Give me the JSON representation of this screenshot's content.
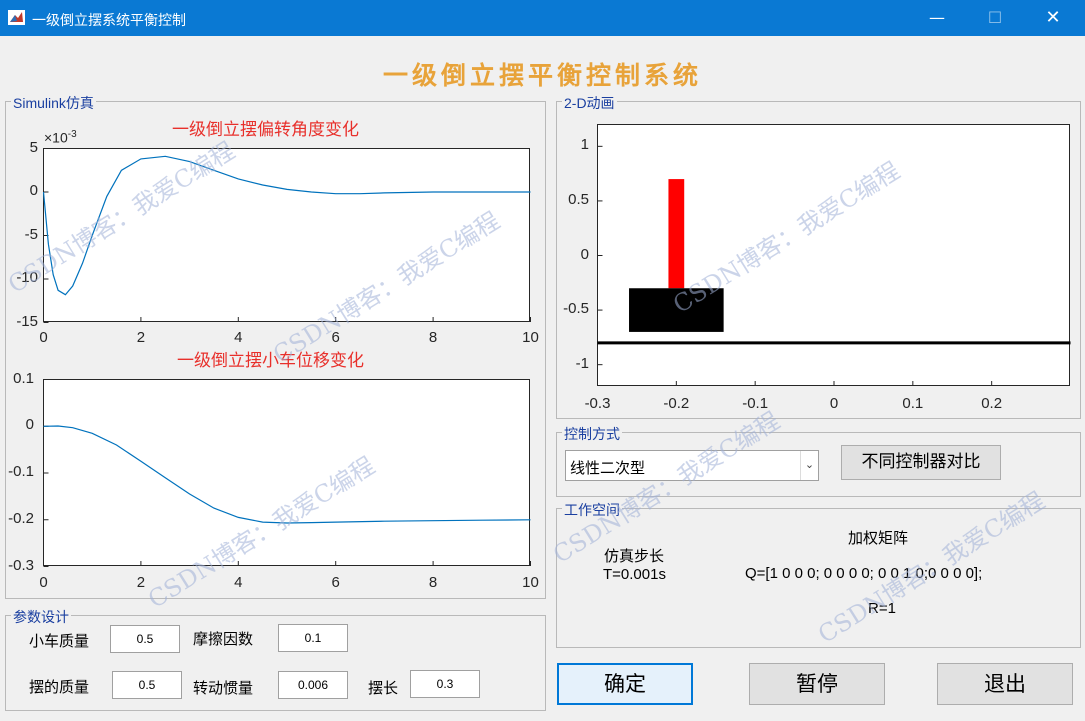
{
  "window": {
    "title": "一级倒立摆系统平衡控制",
    "minimize_glyph": "—",
    "maximize_glyph": "☐",
    "close_glyph": "✕"
  },
  "main_title": "一级倒立摆平衡控制系统",
  "simulink_panel": {
    "label": "Simulink仿真",
    "angle_plot": {
      "title": "一级倒立摆偏转角度变化",
      "exponent": "×10",
      "exponent_power": "-3",
      "yticks": [
        "5",
        "0",
        "-5",
        "-10",
        "-15"
      ],
      "xticks": [
        "0",
        "2",
        "4",
        "6",
        "8",
        "10"
      ]
    },
    "cart_plot": {
      "title": "一级倒立摆小车位移变化",
      "yticks": [
        "0.1",
        "0",
        "-0.1",
        "-0.2",
        "-0.3"
      ],
      "xticks": [
        "0",
        "2",
        "4",
        "6",
        "8",
        "10"
      ]
    }
  },
  "chart_data": [
    {
      "type": "line",
      "title": "一级倒立摆偏转角度变化",
      "xlim": [
        0,
        10
      ],
      "ylim": [
        -0.015,
        0.005
      ],
      "y_scale_factor": "×10^-3",
      "series": [
        {
          "x": [
            0,
            0.1,
            0.2,
            0.3,
            0.45,
            0.6,
            0.8,
            1.0,
            1.3,
            1.6,
            2.0,
            2.5,
            3.0,
            3.5,
            4.0,
            4.5,
            5.0,
            5.5,
            6.0,
            6.5,
            7.0,
            8.0,
            9.0,
            10.0
          ],
          "y": [
            0,
            -0.006,
            -0.0095,
            -0.0113,
            -0.0118,
            -0.0108,
            -0.0082,
            -0.005,
            -0.0005,
            0.0025,
            0.0038,
            0.0041,
            0.0035,
            0.0025,
            0.0015,
            0.0008,
            0.0003,
            0.0,
            -0.0002,
            -0.0002,
            -0.0001,
            0,
            0,
            0
          ]
        }
      ]
    },
    {
      "type": "line",
      "title": "一级倒立摆小车位移变化",
      "xlim": [
        0,
        10
      ],
      "ylim": [
        -0.3,
        0.1
      ],
      "series": [
        {
          "x": [
            0,
            0.3,
            0.6,
            1.0,
            1.5,
            2.0,
            2.5,
            3.0,
            3.5,
            4.0,
            4.5,
            5.0,
            5.5,
            6.0,
            7.0,
            8.0,
            9.0,
            10.0
          ],
          "y": [
            0,
            0.0005,
            -0.003,
            -0.015,
            -0.04,
            -0.075,
            -0.11,
            -0.145,
            -0.175,
            -0.195,
            -0.205,
            -0.207,
            -0.206,
            -0.205,
            -0.203,
            -0.202,
            -0.201,
            -0.2
          ]
        }
      ]
    },
    {
      "type": "scatter",
      "title": "2-D动画",
      "xlim": [
        -0.3,
        0.3
      ],
      "ylim": [
        -1.2,
        1.2
      ],
      "shapes": {
        "ground_y": -0.8,
        "pendulum": {
          "x_left": -0.21,
          "x_right": -0.19,
          "y_bottom": -0.3,
          "y_top": 0.7,
          "color": "#ff0000"
        },
        "cart": {
          "x_left": -0.26,
          "x_right": -0.14,
          "y_bottom": -0.7,
          "y_top": -0.3,
          "color": "#000000"
        }
      }
    }
  ],
  "animation_panel": {
    "label": "2-D动画",
    "yticks": [
      "1",
      "0.5",
      "0",
      "-0.5",
      "-1"
    ],
    "xticks": [
      "-0.3",
      "-0.2",
      "-0.1",
      "0",
      "0.1",
      "0.2"
    ]
  },
  "params": {
    "label": "参数设计",
    "cart_mass_label": "小车质量",
    "cart_mass_value": "0.5",
    "friction_label": "摩擦因数",
    "friction_value": "0.1",
    "pend_mass_label": "摆的质量",
    "pend_mass_value": "0.5",
    "inertia_label": "转动惯量",
    "inertia_value": "0.006",
    "length_label": "摆长",
    "length_value": "0.3"
  },
  "control": {
    "label": "控制方式",
    "selected": "线性二次型",
    "compare_button": "不同控制器对比"
  },
  "workspace": {
    "label": "工作空间",
    "step_title": "仿真步长",
    "step_value": "T=0.001s",
    "matrix_title": "加权矩阵",
    "q_value": "Q=[1 0 0 0; 0 0 0 0; 0 0 1 0;0 0 0 0];",
    "r_value": "R=1"
  },
  "buttons": {
    "ok": "确定",
    "pause": "暂停",
    "exit": "退出"
  },
  "watermark": "CSDN博客：我爱C编程",
  "colors": {
    "titlebar": "#0a79d3",
    "main_title": "#e8a33a",
    "axes_title": "#e8302b",
    "line": "#0072bd",
    "pendulum": "#ff0000",
    "cart": "#000000",
    "panel_label": "#1a3fa0"
  }
}
